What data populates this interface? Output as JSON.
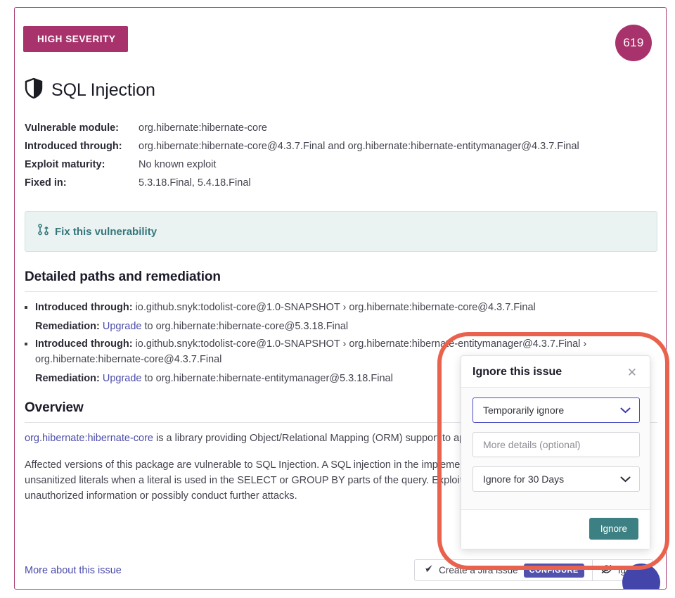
{
  "card": {
    "severity_label": "HIGH SEVERITY",
    "score": "619",
    "title": "SQL Injection",
    "title_icon": "shield-icon"
  },
  "meta": {
    "rows": [
      {
        "label": "Vulnerable module:",
        "value": "org.hibernate:hibernate-core"
      },
      {
        "label": "Introduced through:",
        "value": "org.hibernate:hibernate-core@4.3.7.Final and org.hibernate:hibernate-entitymanager@4.3.7.Final"
      },
      {
        "label": "Exploit maturity:",
        "value": "No known exploit"
      },
      {
        "label": "Fixed in:",
        "value": "5.3.18.Final, 5.4.18.Final"
      }
    ]
  },
  "fix_banner": {
    "label": "Fix this vulnerability",
    "icon": "pull-request-icon"
  },
  "detailed": {
    "heading": "Detailed paths and remediation",
    "paths": [
      {
        "label": "Introduced through:",
        "value": "io.github.snyk:todolist-core@1.0-SNAPSHOT › org.hibernate:hibernate-core@4.3.7.Final",
        "remediation_label": "Remediation:",
        "remediation_link": "Upgrade",
        "remediation_rest": " to org.hibernate:hibernate-core@5.3.18.Final"
      },
      {
        "label": "Introduced through:",
        "value": "io.github.snyk:todolist-core@1.0-SNAPSHOT › org.hibernate:hibernate-entitymanager@4.3.7.Final › org.hibernate:hibernate-core@4.3.7.Final",
        "remediation_label": "Remediation:",
        "remediation_link": "Upgrade",
        "remediation_rest": " to org.hibernate:hibernate-entitymanager@5.3.18.Final"
      }
    ]
  },
  "overview": {
    "heading": "Overview",
    "package_link": "org.hibernate:hibernate-core",
    "paragraph1_rest": " is a library providing Object/Relational Mapping (ORM) support to applications, libraries, and frameworks.",
    "paragraph2": "Affected versions of this package are vulnerable to SQL Injection. A SQL injection in the implementation of the JPA Criteria API can permit unsanitized literals when a literal is used in the SELECT or GROUP BY parts of the query. Exploiting this could allow attackers to access unauthorized information or possibly conduct further attacks."
  },
  "footer": {
    "more_link": "More about this issue",
    "jira_label": "Create a Jira issue",
    "jira_icon": "jira-icon",
    "configure_label": "CONFIGURE",
    "ignore_label": "Ignore",
    "ignore_icon": "eye-slash-icon",
    "fab_icon": "help-fab-icon"
  },
  "modal": {
    "title": "Ignore this issue",
    "close_icon": "close-icon",
    "reason_value": "Temporarily ignore",
    "details_placeholder": "More details (optional)",
    "duration_value": "Ignore for 30 Days",
    "submit_label": "Ignore",
    "chevron_icon": "chevron-down-icon"
  },
  "colors": {
    "severity": "#a8336c",
    "accent_teal": "#3d8083",
    "link": "#4b4bab",
    "configure": "#5152ae",
    "highlight_ring": "#e9624d"
  }
}
